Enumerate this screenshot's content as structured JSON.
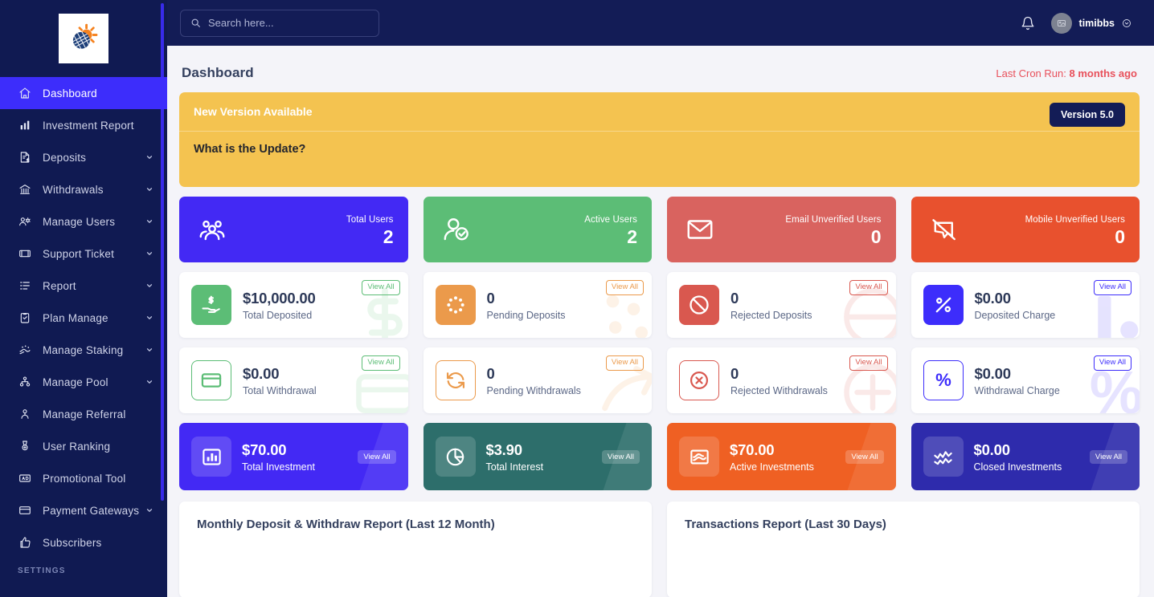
{
  "sidebar": {
    "logo_alt": "globe-sun-logo",
    "items": [
      {
        "label": "Dashboard",
        "icon": "home-icon",
        "caret": false,
        "active": true
      },
      {
        "label": "Investment Report",
        "icon": "bar-chart-icon",
        "caret": false,
        "active": false
      },
      {
        "label": "Deposits",
        "icon": "invoice-dollar-icon",
        "caret": true,
        "active": false
      },
      {
        "label": "Withdrawals",
        "icon": "bank-icon",
        "caret": true,
        "active": false
      },
      {
        "label": "Manage Users",
        "icon": "users-gear-icon",
        "caret": true,
        "active": false
      },
      {
        "label": "Support Ticket",
        "icon": "ticket-icon",
        "caret": true,
        "active": false
      },
      {
        "label": "Report",
        "icon": "list-icon",
        "caret": true,
        "active": false
      },
      {
        "label": "Plan Manage",
        "icon": "clipboard-check-icon",
        "caret": true,
        "active": false
      },
      {
        "label": "Manage Staking",
        "icon": "staking-icon",
        "caret": true,
        "active": false
      },
      {
        "label": "Manage Pool",
        "icon": "pool-icon",
        "caret": true,
        "active": false
      },
      {
        "label": "Manage Referral",
        "icon": "referral-icon",
        "caret": false,
        "active": false
      },
      {
        "label": "User Ranking",
        "icon": "medal-icon",
        "caret": false,
        "active": false
      },
      {
        "label": "Promotional Tool",
        "icon": "ad-icon",
        "caret": false,
        "active": false
      },
      {
        "label": "Payment Gateways",
        "icon": "card-icon",
        "caret": true,
        "active": false
      },
      {
        "label": "Subscribers",
        "icon": "thumbs-up-icon",
        "caret": false,
        "active": false
      }
    ],
    "section_title": "SETTINGS"
  },
  "topbar": {
    "search_placeholder": "Search here...",
    "search_value": "",
    "search_icon": "search-icon",
    "bell_icon": "bell-icon",
    "avatar_icon": "image-placeholder-icon",
    "username": "timibbs",
    "user_caret_icon": "chevron-down-circle-icon"
  },
  "page": {
    "title": "Dashboard",
    "cron_label": "Last Cron Run:",
    "cron_value": "8 months ago"
  },
  "banner": {
    "title": "New Version Available",
    "badge": "Version 5.0",
    "question": "What is the Update?",
    "bg": "#f4c350"
  },
  "user_cards": [
    {
      "label": "Total Users",
      "value": "2",
      "bg": "#4329f4",
      "icon": "users-group-icon"
    },
    {
      "label": "Active Users",
      "value": "2",
      "bg": "#5cbd76",
      "icon": "user-check-icon"
    },
    {
      "label": "Email Unverified Users",
      "value": "0",
      "bg": "#d9635f",
      "icon": "envelope-icon"
    },
    {
      "label": "Mobile Unverified Users",
      "value": "0",
      "bg": "#e8512e",
      "icon": "mobile-slash-icon"
    }
  ],
  "deposit_cards": [
    {
      "value": "$10,000.00",
      "label": "Total Deposited",
      "view_all": "View All",
      "color": "#5cbd76",
      "filled": true,
      "icon": "hand-dollar-icon",
      "watermark": "dollar-wm-icon"
    },
    {
      "value": "0",
      "label": "Pending Deposits",
      "view_all": "View All",
      "color": "#eb9a4b",
      "filled": true,
      "icon": "spinner-dots-icon",
      "watermark": "dots-wm-icon"
    },
    {
      "value": "0",
      "label": "Rejected Deposits",
      "view_all": "View All",
      "color": "#d9584f",
      "filled": true,
      "icon": "ban-icon",
      "watermark": "ban-wm-icon"
    },
    {
      "value": "$0.00",
      "label": "Deposited Charge",
      "view_all": "View All",
      "color": "#3d2dfb",
      "filled": true,
      "icon": "percent-icon",
      "watermark": "bar-wm-icon"
    }
  ],
  "withdraw_cards": [
    {
      "value": "$0.00",
      "label": "Total Withdrawal",
      "view_all": "View All",
      "color": "#5cbd76",
      "filled": false,
      "icon": "credit-card-icon",
      "watermark": "card-wm-icon"
    },
    {
      "value": "0",
      "label": "Pending Withdrawals",
      "view_all": "View All",
      "color": "#eb9a4b",
      "filled": false,
      "icon": "refresh-icon",
      "watermark": "arrow-wm-icon"
    },
    {
      "value": "0",
      "label": "Rejected Withdrawals",
      "view_all": "View All",
      "color": "#d9584f",
      "filled": false,
      "icon": "circle-x-icon",
      "watermark": "plus-wm-icon"
    },
    {
      "value": "$0.00",
      "label": "Withdrawal Charge",
      "view_all": "View All",
      "color": "#3d2dfb",
      "filled": false,
      "icon": "percent-sign-icon",
      "watermark": "percent-wm-icon"
    }
  ],
  "investment_cards": [
    {
      "value": "$70.00",
      "label": "Total Investment",
      "view_all": "View All",
      "bg": "#4329f4",
      "icon": "bar-chart-box-icon"
    },
    {
      "value": "$3.90",
      "label": "Total Interest",
      "view_all": "View All",
      "bg": "#2d6e6b",
      "icon": "pie-chart-icon"
    },
    {
      "value": "$70.00",
      "label": "Active Investments",
      "view_all": "View All",
      "bg": "#ef6023",
      "icon": "chart-area-icon"
    },
    {
      "value": "$0.00",
      "label": "Closed Investments",
      "view_all": "View All",
      "bg": "#2e2bac",
      "icon": "zigzag-line-icon"
    }
  ],
  "reports": [
    {
      "title": "Monthly Deposit & Withdraw Report (Last 12 Month)"
    },
    {
      "title": "Transactions Report (Last 30 Days)"
    }
  ]
}
